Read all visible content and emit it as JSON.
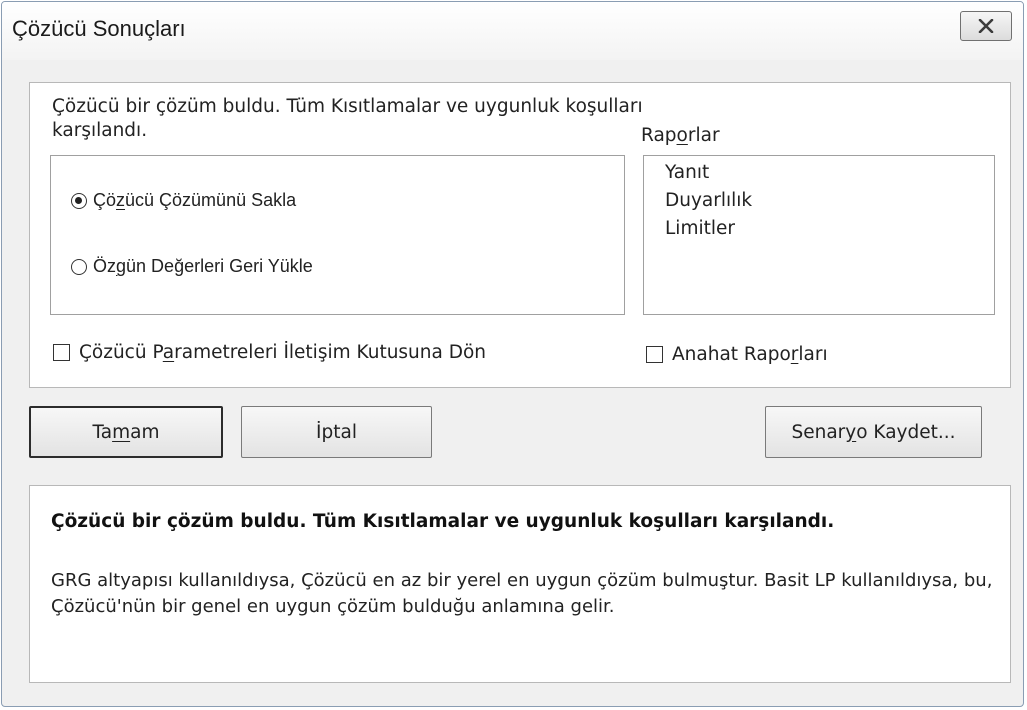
{
  "window": {
    "title": "Çözücü Sonuçları"
  },
  "top_panel": {
    "message": "Çözücü bir çözüm buldu. Tüm Kısıtlamalar ve uygunluk koşulları karşılandı.",
    "options": {
      "keep_solution": {
        "before": "Çö",
        "accel": "z",
        "after": "ücü Çözümünü Sakla",
        "selected": true
      },
      "restore_original": {
        "before": "Öz",
        "accel": "g",
        "after": "ün Değerleri Geri Yükle",
        "selected": false
      }
    },
    "reports": {
      "label_before": "Rap",
      "label_accel": "o",
      "label_after": "rlar",
      "items": [
        "Yanıt",
        "Duyarlılık",
        "Limitler"
      ]
    },
    "return_dialog_checkbox": {
      "before": "Çözücü P",
      "accel": "a",
      "after": "rametreleri İletişim Kutusuna Dön",
      "checked": false
    },
    "outline_reports_checkbox": {
      "before": "Anahat Rapo",
      "accel": "r",
      "after": "ları",
      "checked": false
    }
  },
  "buttons": {
    "ok": {
      "before": "Ta",
      "accel": "m",
      "after": "am"
    },
    "cancel": {
      "label": "İptal"
    },
    "save_scenario": {
      "before": "Senar",
      "accel": "y",
      "after": "o Kaydet..."
    }
  },
  "bottom_panel": {
    "bold_message": "Çözücü bir çözüm buldu. Tüm Kısıtlamalar ve uygunluk koşulları karşılandı.",
    "detail": "GRG altyapısı kullanıldıysa, Çözücü en az bir yerel en uygun çözüm bulmuştur. Basit LP kullanıldıysa, bu, Çözücü'nün bir genel en uygun çözüm bulduğu anlamına gelir."
  }
}
